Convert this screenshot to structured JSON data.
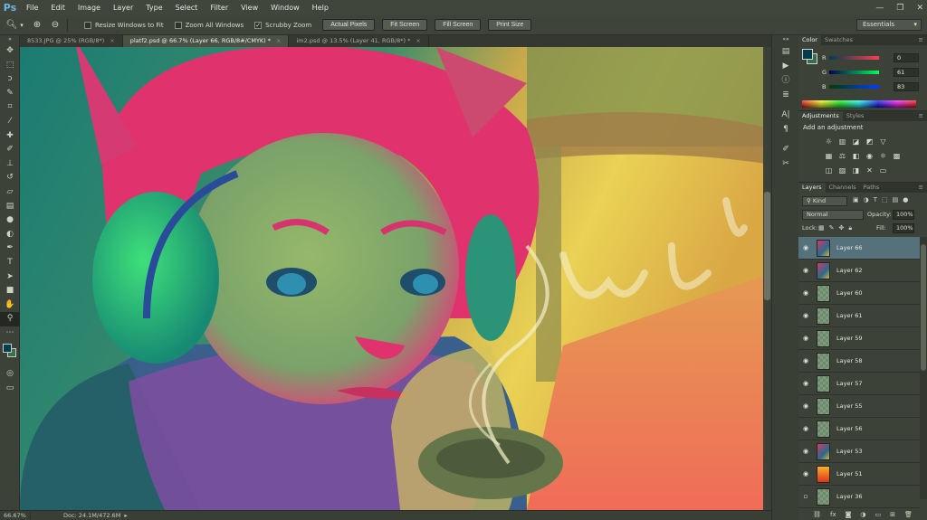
{
  "app": {
    "logo": "Ps"
  },
  "menu": [
    "File",
    "Edit",
    "Image",
    "Layer",
    "Type",
    "Select",
    "Filter",
    "View",
    "Window",
    "Help"
  ],
  "window_controls": {
    "minimize": "—",
    "restore": "❐",
    "close": "✕"
  },
  "options_bar": {
    "resize_windows": {
      "label": "Resize Windows to Fit",
      "checked": false
    },
    "zoom_all": {
      "label": "Zoom All Windows",
      "checked": false
    },
    "scrubby_zoom": {
      "label": "Scrubby Zoom",
      "checked": true
    },
    "actual_pixels": "Actual Pixels",
    "fit_screen": "Fit Screen",
    "fill_screen": "Fill Screen",
    "print_size": "Print Size",
    "workspace": "Essentials"
  },
  "doc_tabs": [
    {
      "label": "8533.JPG @ 25% (RGB/8*)",
      "active": false
    },
    {
      "label": "platf2.psd @ 66.7% (Layer 66, RGB/8#/CMYK) *",
      "active": true
    },
    {
      "label": "im2.psd @ 13.5% (Layer 41, RGB/8*) *",
      "active": false
    }
  ],
  "status": {
    "zoom": "66.67%",
    "doc": "Doc: 24.1M/472.6M"
  },
  "color_panel": {
    "tabs": [
      "Color",
      "Swatches"
    ],
    "r": {
      "label": "R",
      "value": "0"
    },
    "g": {
      "label": "G",
      "value": "61"
    },
    "b": {
      "label": "B",
      "value": "83"
    },
    "fg_color": "#003d53",
    "bg_color": "#3b6f49"
  },
  "adjustments_panel": {
    "tabs": [
      "Adjustments",
      "Styles"
    ],
    "title": "Add an adjustment"
  },
  "layers_panel": {
    "tabs": [
      "Layers",
      "Channels",
      "Paths"
    ],
    "kind": "Kind",
    "blend_mode": "Normal",
    "opacity_label": "Opacity:",
    "opacity": "100%",
    "lock_label": "Lock:",
    "fill_label": "Fill:",
    "fill": "100%",
    "layers": [
      {
        "name": "Layer 66",
        "thumb": "art",
        "visible": true,
        "active": true
      },
      {
        "name": "Layer 62",
        "thumb": "art",
        "visible": true,
        "active": false
      },
      {
        "name": "Layer 60",
        "thumb": "transparent",
        "visible": true,
        "active": false
      },
      {
        "name": "Layer 61",
        "thumb": "transparent",
        "visible": true,
        "active": false
      },
      {
        "name": "Layer 59",
        "thumb": "transparent",
        "visible": true,
        "active": false
      },
      {
        "name": "Layer 58",
        "thumb": "transparent",
        "visible": true,
        "active": false
      },
      {
        "name": "Layer 57",
        "thumb": "transparent",
        "visible": true,
        "active": false
      },
      {
        "name": "Layer 55",
        "thumb": "transparent",
        "visible": true,
        "active": false
      },
      {
        "name": "Layer 56",
        "thumb": "transparent",
        "visible": true,
        "active": false
      },
      {
        "name": "Layer 53",
        "thumb": "art",
        "visible": true,
        "active": false
      },
      {
        "name": "Layer 51",
        "thumb": "fire",
        "visible": true,
        "active": false
      },
      {
        "name": "Layer 36",
        "thumb": "transparent",
        "visible": false,
        "active": false
      }
    ],
    "footer_icons": [
      "link-icon",
      "fx-icon",
      "mask-icon",
      "adjustment-icon",
      "group-icon",
      "new-layer-icon",
      "trash-icon"
    ]
  },
  "tools": [
    "move-tool",
    "marquee-tool",
    "lasso-tool",
    "quick-select-tool",
    "crop-tool",
    "eyedropper-tool",
    "healing-tool",
    "brush-tool",
    "clone-stamp-tool",
    "history-brush-tool",
    "eraser-tool",
    "gradient-tool",
    "blur-tool",
    "dodge-tool",
    "pen-tool",
    "type-tool",
    "path-select-tool",
    "shape-tool",
    "hand-tool",
    "zoom-tool"
  ],
  "canvas": {
    "art_text": "WIP"
  }
}
